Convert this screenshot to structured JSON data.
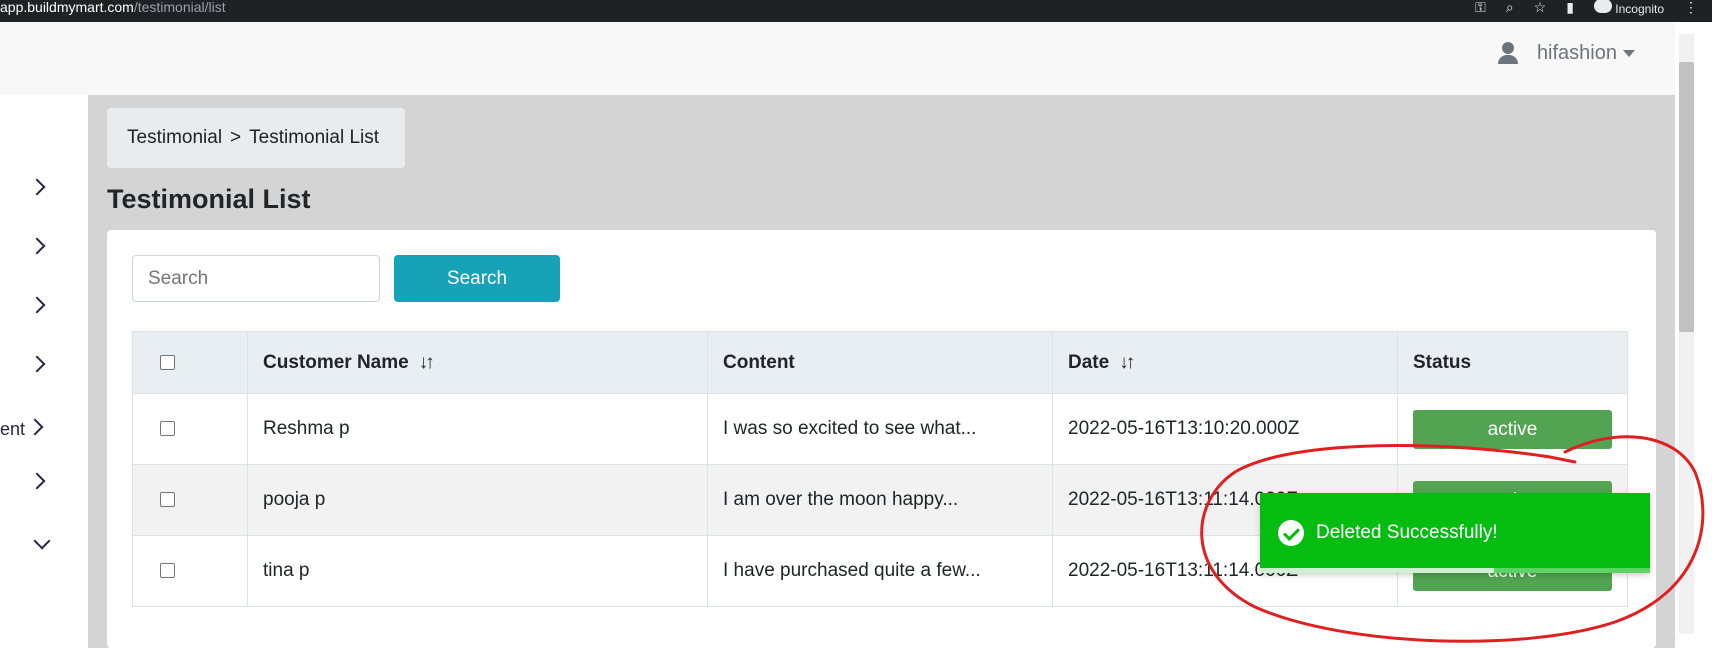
{
  "browser": {
    "url_domain": "app.buildmymart.com",
    "url_path": "/testimonial/list",
    "incognito_label": "Incognito",
    "icons": [
      "key-icon",
      "zoom-icon",
      "star-icon",
      "sidebar-icon",
      "incognito-icon",
      "more-icon"
    ]
  },
  "header": {
    "username": "hifashion",
    "user_icon": "user-icon"
  },
  "sidebar": {
    "items": [
      {
        "icon": "chevron-right-icon",
        "label": ""
      },
      {
        "icon": "chevron-right-icon",
        "label": ""
      },
      {
        "icon": "chevron-right-icon",
        "label": ""
      },
      {
        "icon": "chevron-right-icon",
        "label": ""
      },
      {
        "icon": "chevron-right-icon",
        "label": "ent"
      },
      {
        "icon": "chevron-right-icon",
        "label": ""
      },
      {
        "icon": "chevron-down-icon",
        "label": ""
      }
    ]
  },
  "breadcrumb": {
    "parent": "Testimonial",
    "separator": ">",
    "current": "Testimonial List"
  },
  "page": {
    "title": "Testimonial List"
  },
  "search": {
    "placeholder": "Search",
    "value": "",
    "button_label": "Search"
  },
  "table": {
    "columns": [
      "Customer Name",
      "Content",
      "Date",
      "Status"
    ],
    "sort_icon": "↓↑",
    "rows": [
      {
        "name": "Reshma p",
        "content": "I was so excited to see what...",
        "date": "2022-05-16T13:10:20.000Z",
        "status": "active"
      },
      {
        "name": "pooja p",
        "content": "I am over the moon happy...",
        "date": "2022-05-16T13:11:14.000Z",
        "status": "active"
      },
      {
        "name": "tina p",
        "content": "I have purchased quite a few...",
        "date": "2022-05-16T13:11:14.000Z",
        "status": "active"
      }
    ]
  },
  "toast": {
    "message": "Deleted Successfully!",
    "progress": 0.6
  },
  "colors": {
    "accent": "#17a2b8",
    "status_active": "#52a352",
    "toast_success": "#05bd11",
    "annotation": "#e02020"
  }
}
